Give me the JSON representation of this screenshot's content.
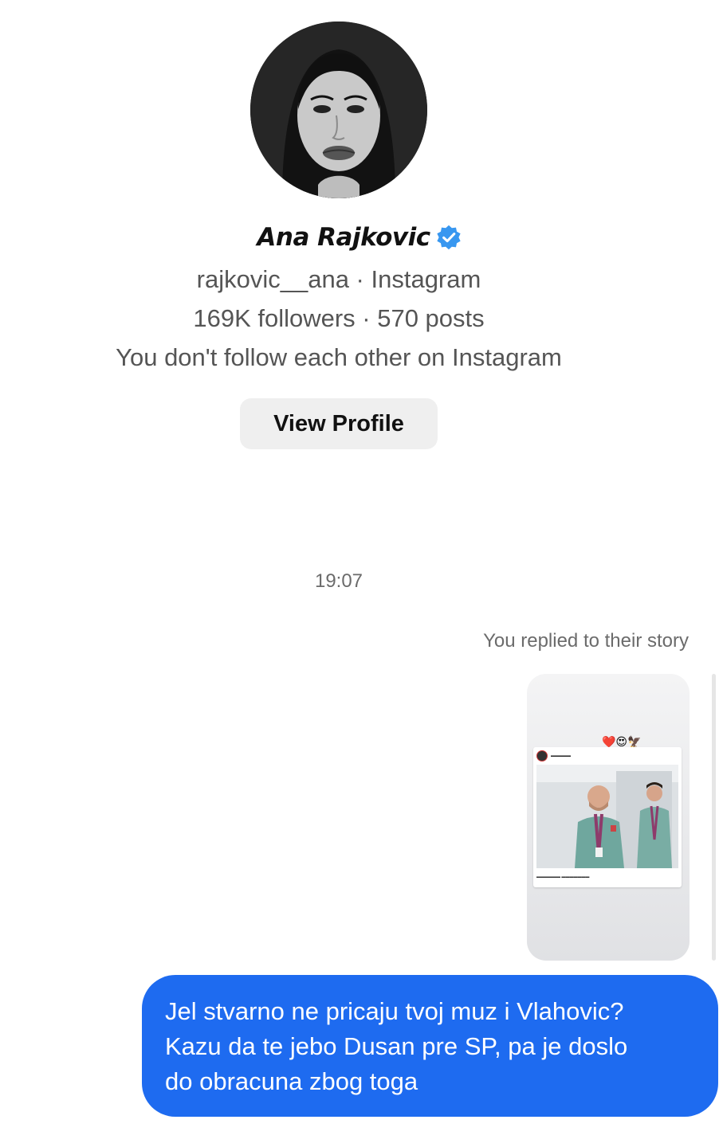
{
  "profile": {
    "name": "Ana Rajkovic",
    "handle_line": "rajkovic__ana · Instagram",
    "stats_line": "169K followers · 570 posts",
    "relationship_line": "You don't follow each other on Instagram",
    "view_profile_label": "View Profile",
    "verified_color": "#3897f0"
  },
  "conversation": {
    "timestamp": "19:07",
    "story_caption": "You replied to their story",
    "story_reactions": "❤️😍🦅",
    "message_lines": [
      "Jel stvarno ne pricaju tvoj muz i Vlahovic?",
      "Kazu da te jebo Dusan pre SP, pa je doslo",
      "do obracuna zbog toga"
    ],
    "bubble_color": "#1e6bf0"
  }
}
